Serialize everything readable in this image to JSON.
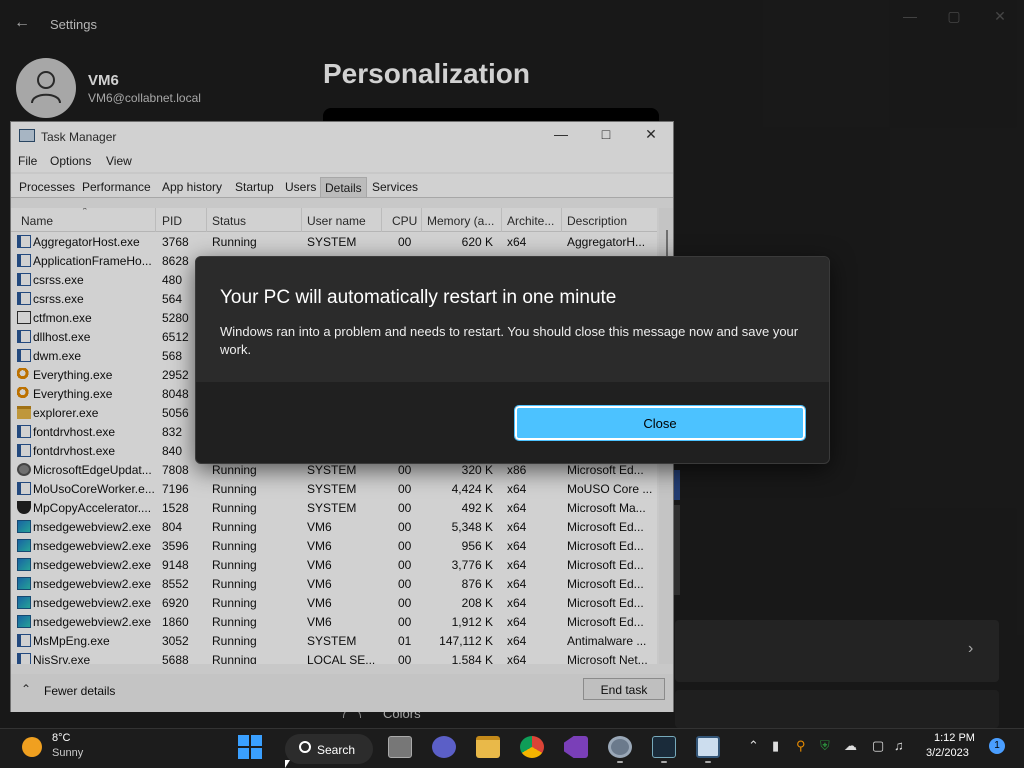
{
  "settings": {
    "title": "Settings",
    "user_name": "VM6",
    "user_email": "VM6@collabnet.local",
    "page_title": "Personalization",
    "colors_label": "Colors"
  },
  "taskmgr": {
    "title": "Task Manager",
    "menu": [
      "File",
      "Options",
      "View"
    ],
    "tabs": [
      "Processes",
      "Performance",
      "App history",
      "Startup",
      "Users",
      "Details",
      "Services"
    ],
    "active_tab": "Details",
    "columns": [
      "Name",
      "PID",
      "Status",
      "User name",
      "CPU",
      "Memory (a...",
      "Archite...",
      "Description"
    ],
    "rows": [
      {
        "icon": "app",
        "name": "AggregatorHost.exe",
        "pid": "3768",
        "status": "Running",
        "user": "SYSTEM",
        "cpu": "00",
        "mem": "620 K",
        "arch": "x64",
        "desc": "AggregatorH..."
      },
      {
        "icon": "app",
        "name": "ApplicationFrameHo...",
        "pid": "8628"
      },
      {
        "icon": "app",
        "name": "csrss.exe",
        "pid": "480"
      },
      {
        "icon": "app",
        "name": "csrss.exe",
        "pid": "564"
      },
      {
        "icon": "pen",
        "name": "ctfmon.exe",
        "pid": "5280"
      },
      {
        "icon": "app",
        "name": "dllhost.exe",
        "pid": "6512"
      },
      {
        "icon": "app",
        "name": "dwm.exe",
        "pid": "568"
      },
      {
        "icon": "find",
        "name": "Everything.exe",
        "pid": "2952"
      },
      {
        "icon": "find",
        "name": "Everything.exe",
        "pid": "8048"
      },
      {
        "icon": "folder",
        "name": "explorer.exe",
        "pid": "5056"
      },
      {
        "icon": "app",
        "name": "fontdrvhost.exe",
        "pid": "832"
      },
      {
        "icon": "app",
        "name": "fontdrvhost.exe",
        "pid": "840"
      },
      {
        "icon": "gear",
        "name": "MicrosoftEdgeUpdat...",
        "pid": "7808",
        "status": "Running",
        "user": "SYSTEM",
        "cpu": "00",
        "mem": "320 K",
        "arch": "x86",
        "desc": "Microsoft Ed..."
      },
      {
        "icon": "app",
        "name": "MoUsoCoreWorker.e...",
        "pid": "7196",
        "status": "Running",
        "user": "SYSTEM",
        "cpu": "00",
        "mem": "4,424 K",
        "arch": "x64",
        "desc": "MoUSO Core ..."
      },
      {
        "icon": "shield",
        "name": "MpCopyAccelerator....",
        "pid": "1528",
        "status": "Running",
        "user": "SYSTEM",
        "cpu": "00",
        "mem": "492 K",
        "arch": "x64",
        "desc": "Microsoft Ma..."
      },
      {
        "icon": "edge",
        "name": "msedgewebview2.exe",
        "pid": "804",
        "status": "Running",
        "user": "VM6",
        "cpu": "00",
        "mem": "5,348 K",
        "arch": "x64",
        "desc": "Microsoft Ed..."
      },
      {
        "icon": "edge",
        "name": "msedgewebview2.exe",
        "pid": "3596",
        "status": "Running",
        "user": "VM6",
        "cpu": "00",
        "mem": "956 K",
        "arch": "x64",
        "desc": "Microsoft Ed..."
      },
      {
        "icon": "edge",
        "name": "msedgewebview2.exe",
        "pid": "9148",
        "status": "Running",
        "user": "VM6",
        "cpu": "00",
        "mem": "3,776 K",
        "arch": "x64",
        "desc": "Microsoft Ed..."
      },
      {
        "icon": "edge",
        "name": "msedgewebview2.exe",
        "pid": "8552",
        "status": "Running",
        "user": "VM6",
        "cpu": "00",
        "mem": "876 K",
        "arch": "x64",
        "desc": "Microsoft Ed..."
      },
      {
        "icon": "edge",
        "name": "msedgewebview2.exe",
        "pid": "6920",
        "status": "Running",
        "user": "VM6",
        "cpu": "00",
        "mem": "208 K",
        "arch": "x64",
        "desc": "Microsoft Ed..."
      },
      {
        "icon": "edge",
        "name": "msedgewebview2.exe",
        "pid": "1860",
        "status": "Running",
        "user": "VM6",
        "cpu": "00",
        "mem": "1,912 K",
        "arch": "x64",
        "desc": "Microsoft Ed..."
      },
      {
        "icon": "app",
        "name": "MsMpEng.exe",
        "pid": "3052",
        "status": "Running",
        "user": "SYSTEM",
        "cpu": "01",
        "mem": "147,112 K",
        "arch": "x64",
        "desc": "Antimalware ..."
      },
      {
        "icon": "app",
        "name": "NisSrv.exe",
        "pid": "5688",
        "status": "Running",
        "user": "LOCAL SE...",
        "cpu": "00",
        "mem": "1,584 K",
        "arch": "x64",
        "desc": "Microsoft Net..."
      }
    ],
    "fewer_details": "Fewer details",
    "end_task": "End task"
  },
  "dialog": {
    "title": "Your PC will automatically restart in one minute",
    "message": "Windows ran into a problem and needs to restart. You should close this message now and save your work.",
    "close_label": "Close",
    "accent_color": "#4cc2ff"
  },
  "taskbar": {
    "weather_temp": "8°C",
    "weather_condition": "Sunny",
    "search_label": "Search",
    "time": "1:12 PM",
    "date": "3/2/2023",
    "notification_count": "1",
    "pinned": [
      "file-explorer-icon",
      "teams-chat-icon",
      "folder-icon",
      "chrome-icon",
      "visual-studio-icon",
      "settings-icon",
      "task-manager-icon",
      "remote-desktop-icon"
    ]
  }
}
